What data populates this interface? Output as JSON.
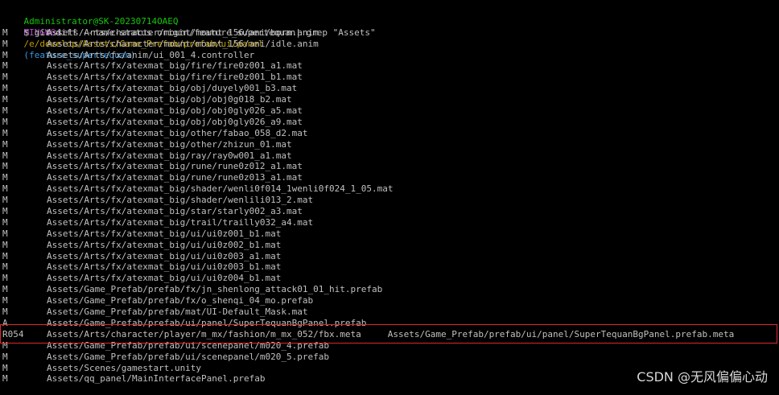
{
  "prompt": {
    "user_host": "Administrator@SK-20230714OAEQ",
    "system": "MINGW64",
    "path": "/e/develop/Assets/Game_Prefab/prefab/ui/panel",
    "branch": "(feature_supertequan)"
  },
  "command": "$ git diff --name-status origin/feature_supertequan| grep \"Assets\"",
  "rows": [
    {
      "status": "M",
      "path": "Assets/Arts/character/mount/mount_156/ani/born.anim"
    },
    {
      "status": "M",
      "path": "Assets/Arts/character/mount/mount_156/ani/idle.anim"
    },
    {
      "status": "M",
      "path": "Assets/Arts/fx/anim/ui_001_4.controller"
    },
    {
      "status": "M",
      "path": "Assets/Arts/fx/atexmat_big/fire/fire0z001_a1.mat"
    },
    {
      "status": "M",
      "path": "Assets/Arts/fx/atexmat_big/fire/fire0z001_b1.mat"
    },
    {
      "status": "M",
      "path": "Assets/Arts/fx/atexmat_big/obj/duyely001_b3.mat"
    },
    {
      "status": "M",
      "path": "Assets/Arts/fx/atexmat_big/obj/obj0g018_b2.mat"
    },
    {
      "status": "M",
      "path": "Assets/Arts/fx/atexmat_big/obj/obj0gly026_a5.mat"
    },
    {
      "status": "M",
      "path": "Assets/Arts/fx/atexmat_big/obj/obj0gly026_a9.mat"
    },
    {
      "status": "M",
      "path": "Assets/Arts/fx/atexmat_big/other/fabao_058_d2.mat"
    },
    {
      "status": "M",
      "path": "Assets/Arts/fx/atexmat_big/other/zhizun_01.mat"
    },
    {
      "status": "M",
      "path": "Assets/Arts/fx/atexmat_big/ray/ray0w001_a1.mat"
    },
    {
      "status": "M",
      "path": "Assets/Arts/fx/atexmat_big/rune/rune0z012_a1.mat"
    },
    {
      "status": "M",
      "path": "Assets/Arts/fx/atexmat_big/rune/rune0z013_a1.mat"
    },
    {
      "status": "M",
      "path": "Assets/Arts/fx/atexmat_big/shader/wenli0f014_1wenli0f024_1_05.mat"
    },
    {
      "status": "M",
      "path": "Assets/Arts/fx/atexmat_big/shader/wenlili013_2.mat"
    },
    {
      "status": "M",
      "path": "Assets/Arts/fx/atexmat_big/star/starly002_a3.mat"
    },
    {
      "status": "M",
      "path": "Assets/Arts/fx/atexmat_big/trail/trailly032_a4.mat"
    },
    {
      "status": "M",
      "path": "Assets/Arts/fx/atexmat_big/ui/ui0z001_b1.mat"
    },
    {
      "status": "M",
      "path": "Assets/Arts/fx/atexmat_big/ui/ui0z002_b1.mat"
    },
    {
      "status": "M",
      "path": "Assets/Arts/fx/atexmat_big/ui/ui0z003_a1.mat"
    },
    {
      "status": "M",
      "path": "Assets/Arts/fx/atexmat_big/ui/ui0z003_b1.mat"
    },
    {
      "status": "M",
      "path": "Assets/Arts/fx/atexmat_big/ui/ui0z004_b1.mat"
    },
    {
      "status": "M",
      "path": "Assets/Game_Prefab/prefab/fx/jn_shenlong_attack01_01_hit.prefab"
    },
    {
      "status": "M",
      "path": "Assets/Game_Prefab/prefab/fx/o_shenqi_04_mo.prefab"
    },
    {
      "status": "M",
      "path": "Assets/Game_Prefab/prefab/mat/UI-Default_Mask.mat"
    },
    {
      "status": "A",
      "path": "Assets/Game_Prefab/prefab/ui/panel/SuperTequanBgPanel.prefab"
    },
    {
      "status": "R054",
      "path": "Assets/Arts/character/player/m_mx/fashion/m_mx_052/fbx.meta",
      "new_path": "Assets/Game_Prefab/prefab/ui/panel/SuperTequanBgPanel.prefab.meta"
    },
    {
      "status": "M",
      "path": "Assets/Game_Prefab/prefab/ui/scenepanel/m020_4.prefab"
    },
    {
      "status": "M",
      "path": "Assets/Game_Prefab/prefab/ui/scenepanel/m020_5.prefab"
    },
    {
      "status": "M",
      "path": "Assets/Scenes/gamestart.unity"
    },
    {
      "status": "M",
      "path": "Assets/qq_panel/MainInterfacePanel.prefab"
    }
  ],
  "watermark": "CSDN @无风偏偏心动",
  "colors": {
    "background": "#000000",
    "text": "#c0c0c0",
    "user_host": "#16c60c",
    "system": "#b148c6",
    "path": "#c19c00",
    "branch": "#3a96dd",
    "highlight_box": "#e0262e"
  }
}
